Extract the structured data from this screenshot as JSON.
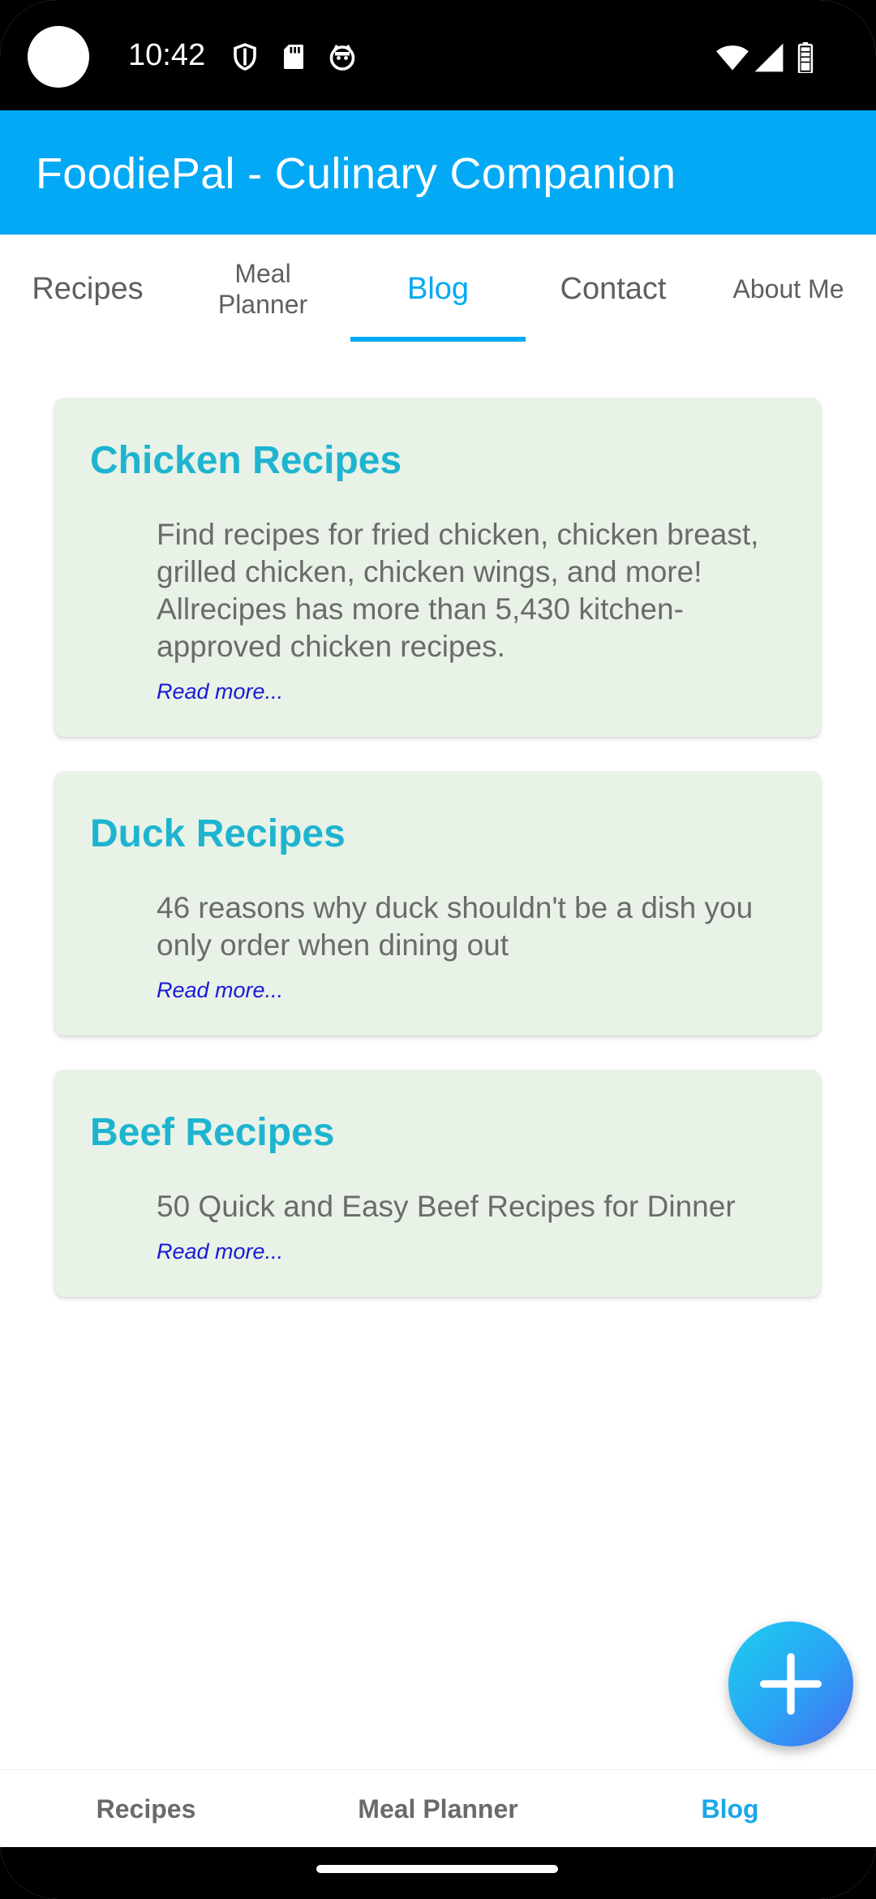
{
  "status_bar": {
    "time": "10:42",
    "left_icons": [
      "shield-icon",
      "sd-card-icon",
      "cat-face-icon"
    ],
    "right_icons": [
      "wifi-icon",
      "signal-icon",
      "battery-icon"
    ]
  },
  "app_bar": {
    "title": "FoodiePal - Culinary Companion",
    "color": "#03a9f4"
  },
  "top_tabs": {
    "items": [
      {
        "label": "Recipes"
      },
      {
        "label": "Meal\nPlanner"
      },
      {
        "label": "Blog"
      },
      {
        "label": "Contact"
      },
      {
        "label": "About Me"
      }
    ],
    "active_index": 2,
    "accent": "#03a9f4"
  },
  "posts": [
    {
      "title": "Chicken Recipes",
      "description": "Find recipes for fried chicken, chicken breast, grilled chicken, chicken wings, and more! Allrecipes has more than 5,430 kitchen-approved chicken recipes.",
      "link": "Read more..."
    },
    {
      "title": "Duck Recipes",
      "description": "46 reasons why duck shouldn't be a dish you only order when dining out",
      "link": "Read more..."
    },
    {
      "title": "Beef Recipes",
      "description": "50 Quick and Easy Beef Recipes for Dinner",
      "link": "Read more..."
    }
  ],
  "fab": {
    "icon": "plus-icon"
  },
  "bottom_nav": {
    "items": [
      {
        "label": "Recipes"
      },
      {
        "label": "Meal Planner"
      },
      {
        "label": "Blog"
      }
    ],
    "active_index": 2,
    "accent": "#1aa7e8"
  }
}
